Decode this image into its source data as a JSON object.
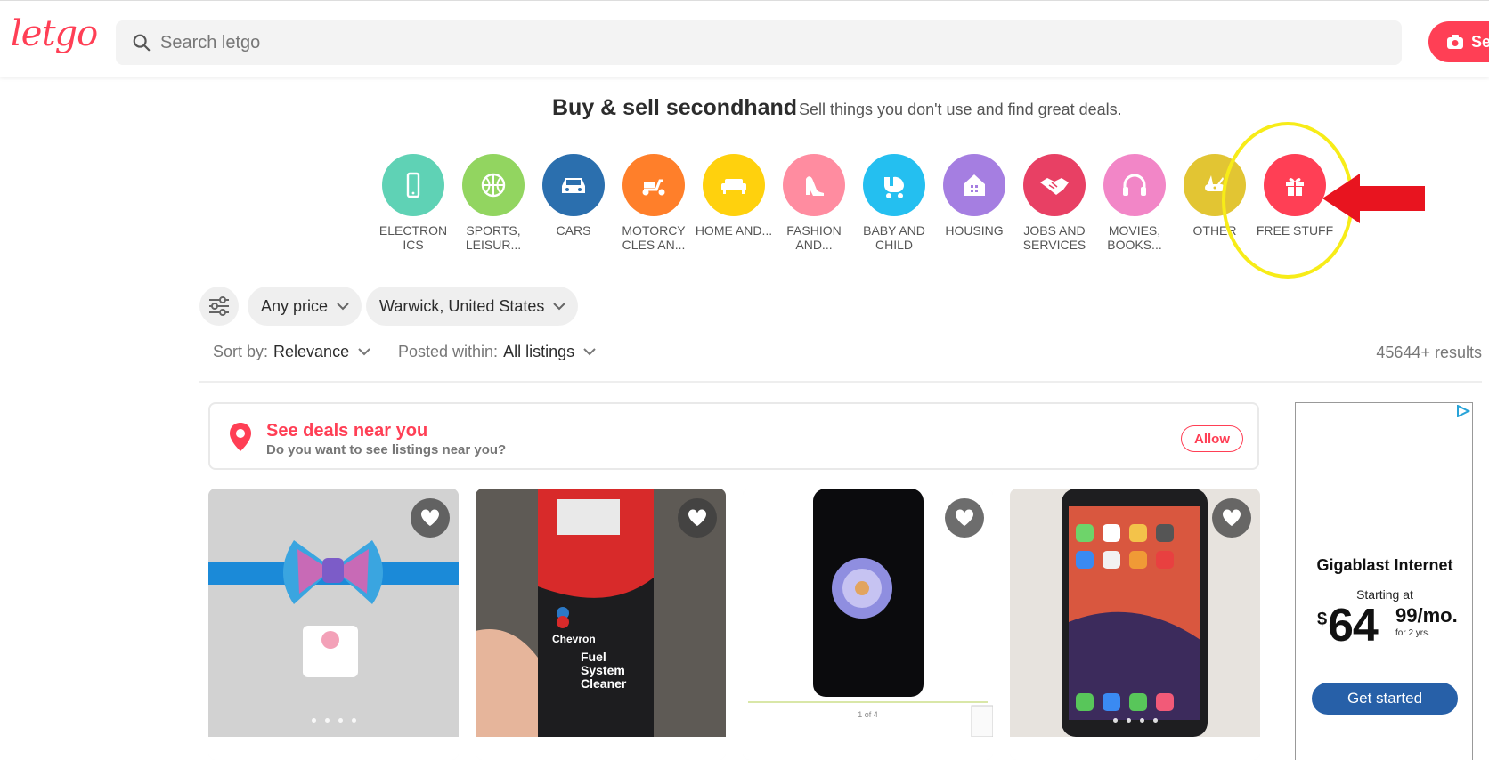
{
  "header": {
    "logo": "letgo",
    "search_placeholder": "Search letgo",
    "sell_label": "Se"
  },
  "hero": {
    "title": "Buy & sell secondhand",
    "subtitle": "Sell things you don't use and find great deals."
  },
  "categories": [
    {
      "label": "ELECTRON ICS",
      "color": "#5fd2b5",
      "icon": "phone-icon"
    },
    {
      "label": "SPORTS, LEISUR...",
      "color": "#92d560",
      "icon": "basketball-icon"
    },
    {
      "label": "CARS",
      "color": "#2b6fae",
      "icon": "car-icon"
    },
    {
      "label": "MOTORCY CLES AN...",
      "color": "#ff7f2a",
      "icon": "scooter-icon"
    },
    {
      "label": "HOME AND...",
      "color": "#ffd10d",
      "icon": "sofa-icon"
    },
    {
      "label": "FASHION AND...",
      "color": "#ff8ca0",
      "icon": "high-heel-icon"
    },
    {
      "label": "BABY AND CHILD",
      "color": "#24bff0",
      "icon": "stroller-icon"
    },
    {
      "label": "HOUSING",
      "color": "#a57ee1",
      "icon": "house-icon"
    },
    {
      "label": "JOBS AND SERVICES",
      "color": "#e84064",
      "icon": "handshake-icon"
    },
    {
      "label": "MOVIES, BOOKS...",
      "color": "#f286c7",
      "icon": "headphones-icon"
    },
    {
      "label": "OTHER",
      "color": "#e2c533",
      "icon": "swiss-knife-icon"
    },
    {
      "label": "FREE STUFF",
      "color": "#ff3f55",
      "icon": "gift-icon"
    }
  ],
  "filters": {
    "price": "Any price",
    "location": "Warwick, United States"
  },
  "sort": {
    "sort_key": "Sort by:",
    "sort_value": "Relevance",
    "posted_key": "Posted within:",
    "posted_value": "All listings",
    "results": "45644+ results"
  },
  "deals": {
    "title": "See deals near you",
    "subtitle": "Do you want to see listings near you?",
    "allow": "Allow"
  },
  "listings": [
    {
      "photo": "bow-headband",
      "images": 4
    },
    {
      "photo": "chevron-fuel-system-cleaner",
      "images": 0
    },
    {
      "photo": "galaxy-phone",
      "images": 4
    },
    {
      "photo": "iphone",
      "images": 4
    }
  ],
  "listing_text": {
    "card2_brand": "Chevron",
    "card2_product": "Fuel System Cleaner",
    "card3_counter": "1 of 4"
  },
  "ad": {
    "title": "Gigablast Internet",
    "starting": "Starting at",
    "dollar": "$",
    "amount": "64",
    "cents": "99/mo.",
    "term": "for 2 yrs.",
    "cta": "Get started"
  },
  "colors": {
    "brand": "#ff3f55",
    "annotation_ring": "#f7ec18",
    "annotation_arrow": "#e8141f",
    "ad_button": "#2760a8"
  }
}
